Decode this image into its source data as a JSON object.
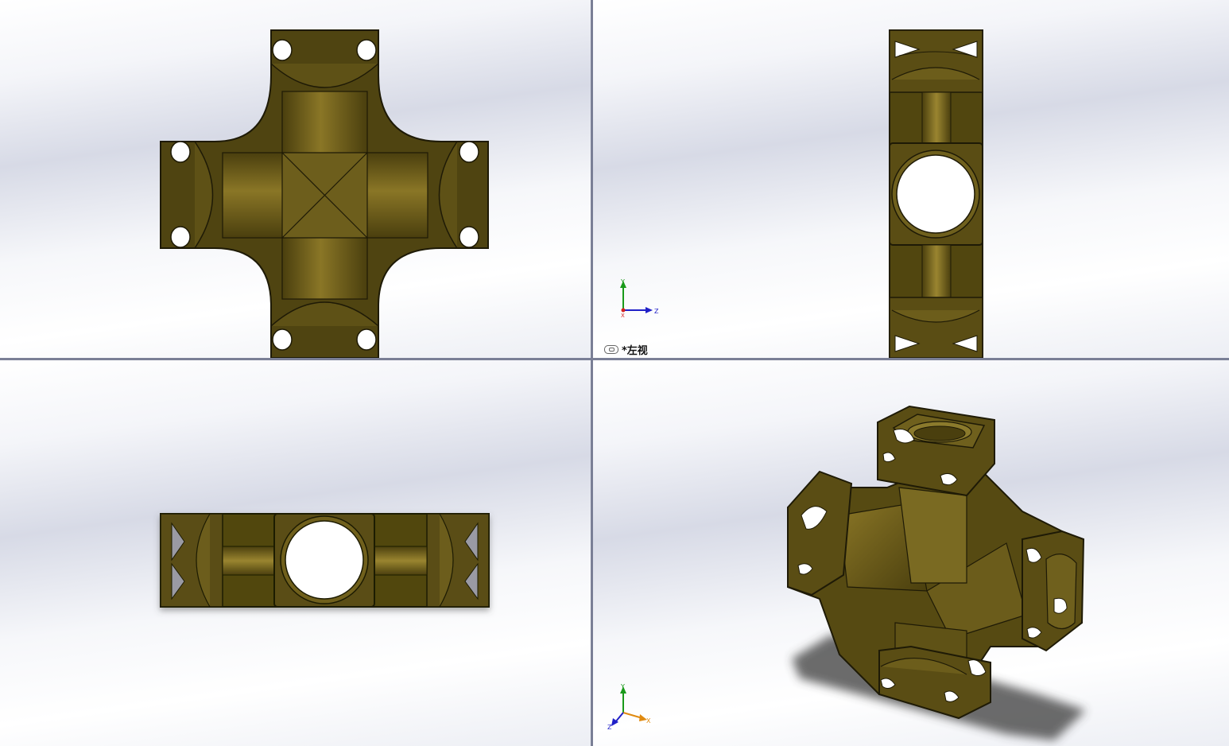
{
  "viewports": {
    "top_left": {
      "name": "front-view"
    },
    "top_right": {
      "name": "left-view",
      "label": "*左视",
      "triad": {
        "up": "Y",
        "right": "Z",
        "origin": "X"
      }
    },
    "bottom_left": {
      "name": "top-view"
    },
    "bottom_right": {
      "name": "isometric-view",
      "triad": {
        "up": "Y",
        "right": "X",
        "left": "Z"
      }
    }
  },
  "colors": {
    "part_dark": "#4e4310",
    "part_mid": "#7a6a1e",
    "part_light": "#a08c34",
    "edge": "#1e1a06",
    "hole": "#ffffff",
    "axis_x": "#d42020",
    "axis_y": "#1a9a1a",
    "axis_z": "#2020c8",
    "axis_x_iso": "#e08a10"
  },
  "icons": [
    "link-icon",
    "coordinate-triad-icon"
  ]
}
